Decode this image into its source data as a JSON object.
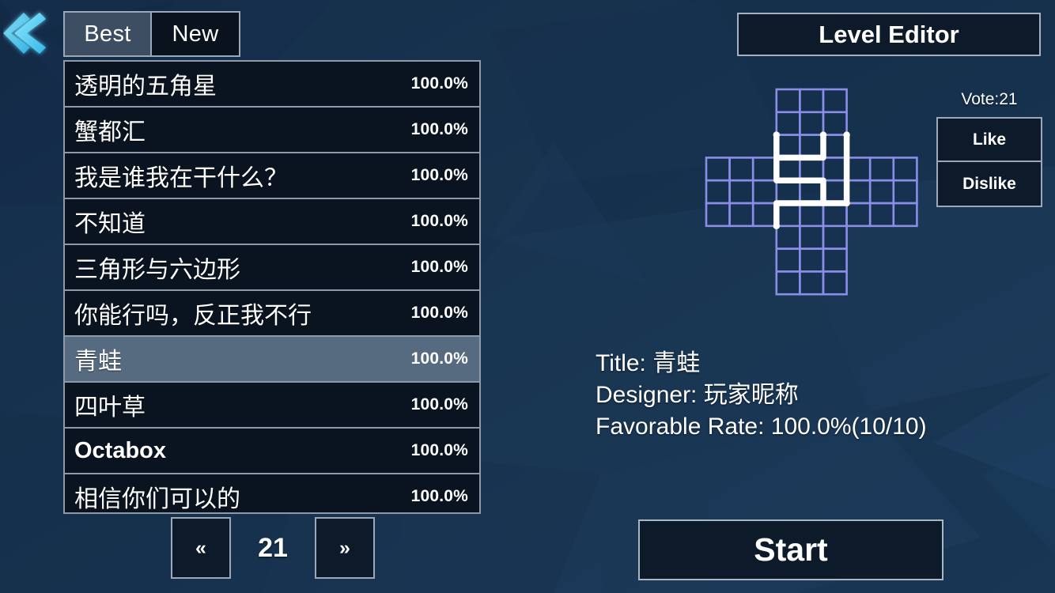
{
  "nav": {
    "back_icon": "chevron-left-icon",
    "tabs": [
      {
        "label": "Best",
        "active": true
      },
      {
        "label": "New",
        "active": false
      }
    ]
  },
  "level_list": {
    "rows": [
      {
        "name": "透明的五角星",
        "rate": "100.0%",
        "selected": false,
        "latin": false
      },
      {
        "name": "蟹都汇",
        "rate": "100.0%",
        "selected": false,
        "latin": false
      },
      {
        "name": "我是谁我在干什么？",
        "rate": "100.0%",
        "selected": false,
        "latin": false
      },
      {
        "name": "不知道",
        "rate": "100.0%",
        "selected": false,
        "latin": false
      },
      {
        "name": "三角形与六边形",
        "rate": "100.0%",
        "selected": false,
        "latin": false
      },
      {
        "name": "你能行吗，反正我不行",
        "rate": "100.0%",
        "selected": false,
        "latin": false
      },
      {
        "name": "青蛙",
        "rate": "100.0%",
        "selected": true,
        "latin": false
      },
      {
        "name": "四叶草",
        "rate": "100.0%",
        "selected": false,
        "latin": false
      },
      {
        "name": "Octabox",
        "rate": "100.0%",
        "selected": false,
        "latin": true
      },
      {
        "name": "相信你们可以的",
        "rate": "100.0%",
        "selected": false,
        "latin": false
      }
    ]
  },
  "pagination": {
    "prev_label": "«",
    "page": "21",
    "next_label": "»"
  },
  "right_panel": {
    "level_editor_label": "Level Editor",
    "vote_label": "Vote:21",
    "like_label": "Like",
    "dislike_label": "Dislike"
  },
  "details": {
    "title_line": "Title: 青蛙",
    "designer_line": "Designer: 玩家昵称",
    "rate_line": "Favorable Rate: 100.0%(10/10)"
  },
  "actions": {
    "start_label": "Start"
  },
  "colors": {
    "background": "#16304f",
    "row_background": "#0a1420",
    "row_selected": "#566a80",
    "row_border": "#8e9aa8",
    "panel_background": "#0d1a2a",
    "panel_border": "#a4b1c0",
    "grid_line": "#8b8ee8",
    "path_line": "#ffffff",
    "back_arrow": "#63d8f5",
    "text": "#ffffff"
  },
  "puzzle": {
    "shape": "plus-cross-9x9",
    "cell_size": 29.6,
    "grid_cols": 9,
    "grid_rows": 9
  }
}
